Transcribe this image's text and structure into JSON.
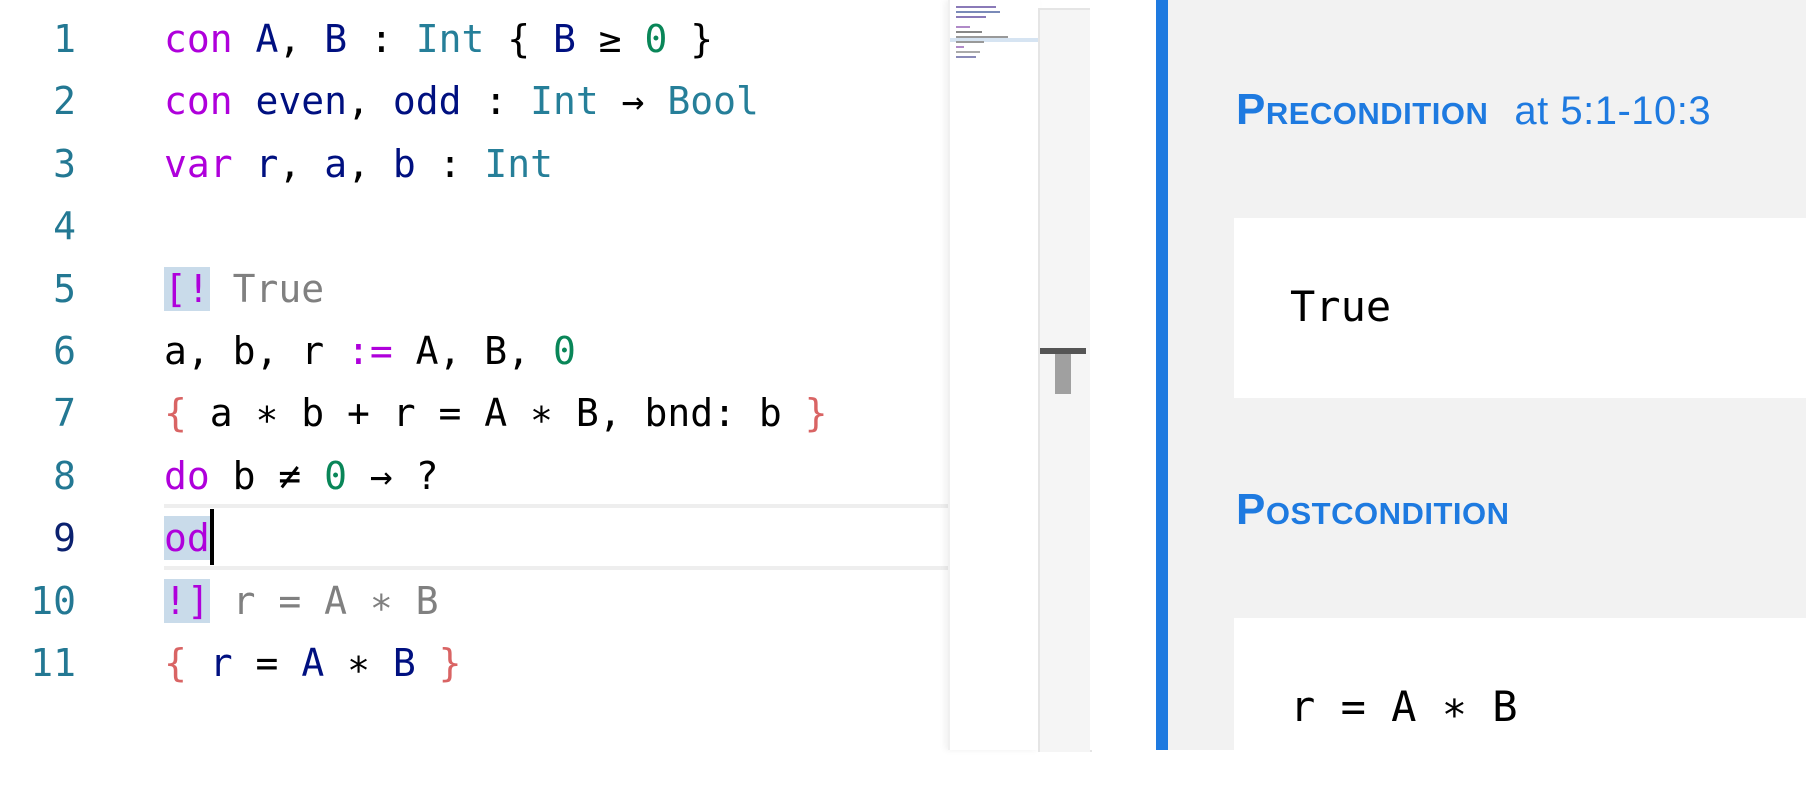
{
  "editor": {
    "lines": [
      {
        "n": "1",
        "tokens": [
          [
            "kw",
            "con"
          ],
          [
            "",
            " "
          ],
          [
            "id",
            "A"
          ],
          [
            "",
            ", "
          ],
          [
            "id",
            "B"
          ],
          [
            "",
            " : "
          ],
          [
            "ty",
            "Int"
          ],
          [
            "",
            " { "
          ],
          [
            "id",
            "B"
          ],
          [
            "",
            " ≥ "
          ],
          [
            "num",
            "0"
          ],
          [
            "",
            " }"
          ]
        ]
      },
      {
        "n": "2",
        "tokens": [
          [
            "kw",
            "con"
          ],
          [
            "",
            " "
          ],
          [
            "id",
            "even"
          ],
          [
            "",
            ", "
          ],
          [
            "id",
            "odd"
          ],
          [
            "",
            " : "
          ],
          [
            "ty",
            "Int"
          ],
          [
            "",
            " → "
          ],
          [
            "ty",
            "Bool"
          ]
        ]
      },
      {
        "n": "3",
        "tokens": [
          [
            "kw",
            "var"
          ],
          [
            "",
            " "
          ],
          [
            "id",
            "r"
          ],
          [
            "",
            ", "
          ],
          [
            "id",
            "a"
          ],
          [
            "",
            ", "
          ],
          [
            "id",
            "b"
          ],
          [
            "",
            " : "
          ],
          [
            "ty",
            "Int"
          ]
        ]
      },
      {
        "n": "4",
        "tokens": []
      },
      {
        "n": "5",
        "tokens": [
          [
            "kw hl",
            "[!"
          ],
          [
            "",
            " "
          ],
          [
            "dim",
            "True"
          ]
        ]
      },
      {
        "n": "6",
        "tokens": [
          [
            "",
            "a, b, r "
          ],
          [
            "kw",
            ":="
          ],
          [
            "",
            " A, B, "
          ],
          [
            "num",
            "0"
          ]
        ]
      },
      {
        "n": "7",
        "tokens": [
          [
            "br",
            "{"
          ],
          [
            "",
            " a ∗ b + r = A ∗ B, bnd: b "
          ],
          [
            "br",
            "}"
          ]
        ]
      },
      {
        "n": "8",
        "tokens": [
          [
            "kw",
            "do"
          ],
          [
            "",
            " b ≠ "
          ],
          [
            "num",
            "0"
          ],
          [
            "",
            " → ?"
          ]
        ]
      },
      {
        "n": "9",
        "tokens": [
          [
            "kw hl",
            "od"
          ],
          [
            "caret",
            ""
          ]
        ]
      },
      {
        "n": "10",
        "tokens": [
          [
            "kw hl",
            "!]"
          ],
          [
            "",
            " "
          ],
          [
            "dim",
            "r = A ∗ B"
          ]
        ]
      },
      {
        "n": "11",
        "tokens": [
          [
            "br",
            "{"
          ],
          [
            "",
            " "
          ],
          [
            "id",
            "r"
          ],
          [
            "",
            " = "
          ],
          [
            "id",
            "A"
          ],
          [
            "",
            " ∗ "
          ],
          [
            "id",
            "B"
          ],
          [
            "",
            " "
          ],
          [
            "br",
            "}"
          ]
        ]
      }
    ],
    "current_line": "9"
  },
  "panel": {
    "precondition_label": "Precondition",
    "precondition_location": "at 5:1-10:3",
    "precondition_value": "True",
    "postcondition_label": "Postcondition",
    "postcondition_value": "r = A ∗ B"
  },
  "colors": {
    "keyword": "#af00db",
    "type": "#267f99",
    "identifier": "#001080",
    "number": "#098658",
    "brace": "#cd3131",
    "accent": "#1e7ae0"
  }
}
